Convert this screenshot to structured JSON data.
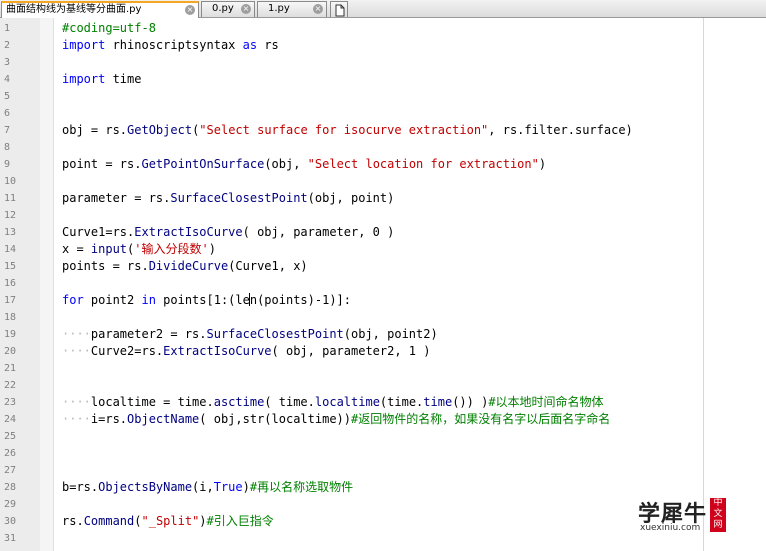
{
  "tabs": [
    {
      "label": "曲面结构线为基线等分曲面.py",
      "active": true
    },
    {
      "label": "0.py",
      "active": false
    },
    {
      "label": "1.py",
      "active": false
    }
  ],
  "close_glyph": "×",
  "editor": {
    "line_numbers": [
      "1",
      "2",
      "3",
      "4",
      "5",
      "6",
      "7",
      "8",
      "9",
      "10",
      "11",
      "12",
      "13",
      "14",
      "15",
      "16",
      "17",
      "18",
      "19",
      "20",
      "21",
      "22",
      "23",
      "24",
      "25",
      "26",
      "27",
      "28",
      "29",
      "30",
      "31"
    ],
    "code": {
      "l1": "#coding=utf-8",
      "l2_kw": "import",
      "l2_rest": " rhinoscriptsyntax ",
      "l2_as": "as",
      "l2_end": " rs",
      "l4_kw": "import",
      "l4_rest": " time",
      "l7_a": "obj = rs.",
      "l7_fn": "GetObject",
      "l7_b": "(",
      "l7_str": "\"Select surface for isocurve extraction\"",
      "l7_c": ", rs.filter.surface)",
      "l9_a": "point = rs.",
      "l9_fn": "GetPointOnSurface",
      "l9_b": "(obj, ",
      "l9_str": "\"Select location for extraction\"",
      "l9_c": ")",
      "l11_a": "parameter = rs.",
      "l11_fn": "SurfaceClosestPoint",
      "l11_b": "(obj, point)",
      "l13_a": "Curve1=rs.",
      "l13_fn": "ExtractIsoCurve",
      "l13_b": "( obj, parameter, 0 )",
      "l14_a": "x = ",
      "l14_fn": "input",
      "l14_b": "(",
      "l14_str": "'输入分段数'",
      "l14_c": ")",
      "l15_a": "points = rs.",
      "l15_fn": "DivideCurve",
      "l15_b": "(Curve1, x)",
      "l17_for": "for",
      "l17_a": " point2 ",
      "l17_in": "in",
      "l17_b": " points[1:(le",
      "l17_c": "n(points)-1)]:",
      "ws": "····",
      "l19_a": "parameter2 = rs.",
      "l19_fn": "SurfaceClosestPoint",
      "l19_b": "(obj, point2)",
      "l20_a": "Curve2=rs.",
      "l20_fn": "ExtractIsoCurve",
      "l20_b": "( obj, parameter2, 1 )",
      "l23_a": "localtime = time.",
      "l23_fn": "asctime",
      "l23_b": "( time.",
      "l23_fn2": "localtime",
      "l23_c": "(time.",
      "l23_fn3": "time",
      "l23_d": "()) )",
      "l23_cmt": "#以本地时间命名物体",
      "l24_a": "i=rs.",
      "l24_fn": "ObjectName",
      "l24_b": "( obj,str(localtime))",
      "l24_cmt": "#返回物件的名称，如果没有名字以后面名字命名",
      "l28_a": "b=rs.",
      "l28_fn": "ObjectsByName",
      "l28_b": "(i,",
      "l28_kw": "True",
      "l28_c": ")",
      "l28_cmt": "#再以名称选取物件",
      "l30_a": "rs.",
      "l30_fn": "Command",
      "l30_b": "(",
      "l30_str": "\"_Split\"",
      "l30_c": ")",
      "l30_cmt": "#引入巨指令"
    }
  },
  "watermark": {
    "brand": "学犀牛",
    "domain": "xuexiniu.com",
    "badge": "中文网"
  }
}
